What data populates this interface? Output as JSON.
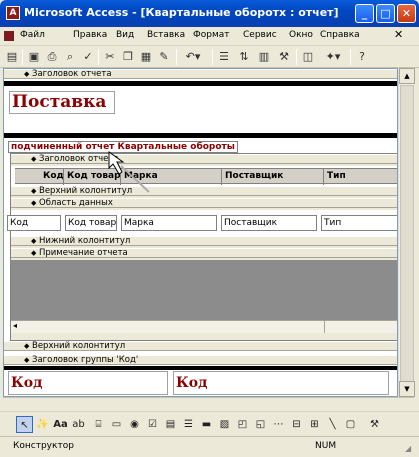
{
  "window": {
    "title": "Microsoft Access - [Квартальные оборотх : отчет]",
    "app_icon": "access-key-icon",
    "min": "_",
    "max": "□",
    "close": "✕"
  },
  "menu": [
    "Файл",
    "Правка",
    "Вид",
    "Вставка",
    "Формат",
    "Сервис",
    "Окно",
    "Справка"
  ],
  "toolbar_icons": [
    "view-icon",
    "save-icon",
    "print-icon",
    "print-preview-icon",
    "spelling-icon",
    "cut-icon",
    "copy-icon",
    "paste-icon",
    "format-painter-icon",
    "undo-icon",
    "field-list-icon",
    "sorting-grouping-icon",
    "properties-icon",
    "build-icon",
    "database-window-icon",
    "new-object-icon",
    "help-icon"
  ],
  "report": {
    "bands": {
      "report_header": "Заголовок отчета",
      "sub_report_header": "Заголовок отчета",
      "page_header": "Верхний колонтитул",
      "detail": "Область данных",
      "page_footer": "Нижний колонтитул",
      "report_footer": "Примечание отчета",
      "main_page_header": "Верхний колонтитул",
      "group_header": "Заголовок группы 'Код'"
    },
    "title": "Поставка",
    "subreport_label": "подчиненный отчет Квартальные обороты",
    "column_headers": [
      "Код",
      "Код товара",
      "Марка",
      "Поставщик",
      "Тип"
    ],
    "detail_fields": [
      "Код",
      "Код товара",
      "Марка",
      "Поставщик",
      "Тип"
    ],
    "group_label": "Код",
    "group_field": "Код"
  },
  "toolbox_icons": [
    "select-objects-icon",
    "control-wizards-icon",
    "label-icon",
    "textbox-icon",
    "option-group-icon",
    "toggle-button-icon",
    "option-button-icon",
    "checkbox-icon",
    "combobox-icon",
    "listbox-icon",
    "command-button-icon",
    "image-icon",
    "unbound-frame-icon",
    "bound-frame-icon",
    "page-break-icon",
    "tab-control-icon",
    "subform-icon",
    "line-icon",
    "rectangle-icon",
    "more-controls-icon"
  ],
  "status": {
    "mode": "Конструктор",
    "num": "NUM"
  }
}
